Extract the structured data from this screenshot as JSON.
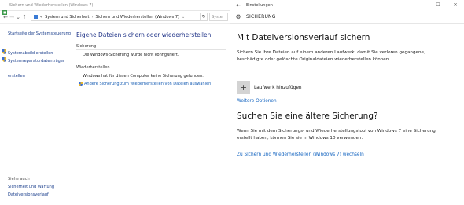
{
  "control_panel": {
    "window_title": "Sichern und Wiederherstellen (Windows 7)",
    "address": {
      "crumb_root": "«",
      "crumb_1": "System und Sicherheit",
      "crumb_2": "Sichern und Wiederherstellen (Windows 7)",
      "search_placeholder": "Syste"
    },
    "sidebar": {
      "home": "Startseite der Systemsteuerung",
      "item_image": "Systemabbild erstellen",
      "item_repair": "Systemreparaturdatenträger erstellen",
      "see_also": "Siehe auch",
      "link_security": "Sicherheit und Wartung",
      "link_history": "Dateiversionsverlauf"
    },
    "main": {
      "heading": "Eigene Dateien sichern oder wiederherstellen",
      "backup_label": "Sicherung",
      "backup_status": "Die Windows-Sicherung wurde nicht konfiguriert.",
      "restore_label": "Wiederherstellen",
      "restore_status": "Windows hat für diesen Computer keine Sicherung gefunden.",
      "restore_link": "Andere Sicherung zum Wiederherstellen von Dateien auswählen"
    }
  },
  "settings": {
    "window_title": "Einstellungen",
    "section_title": "SICHERUNG",
    "heading_1": "Mit Dateiversionsverlauf sichern",
    "paragraph_1": "Sichern Sie Ihre Dateien auf einem anderen Laufwerk, damit Sie verloren gegangene, beschädigte oder gelöschte Originaldateien wiederherstellen können.",
    "add_drive": "Laufwerk hinzufügen",
    "more_options": "Weitere Optionen",
    "heading_2": "Suchen Sie eine ältere Sicherung?",
    "paragraph_2": "Wenn Sie mit dem Sicherungs- und Wiederherstellungstool von Windows 7 eine Sicherung erstellt haben, können Sie sie in Windows 10 verwenden.",
    "win7_link": "Zu Sichern und Wiederherstellen (Windows 7) wechseln"
  },
  "colors": {
    "cp_heading": "#1e3287",
    "link": "#1565c0",
    "plus_tile": "#d3d3d3"
  }
}
